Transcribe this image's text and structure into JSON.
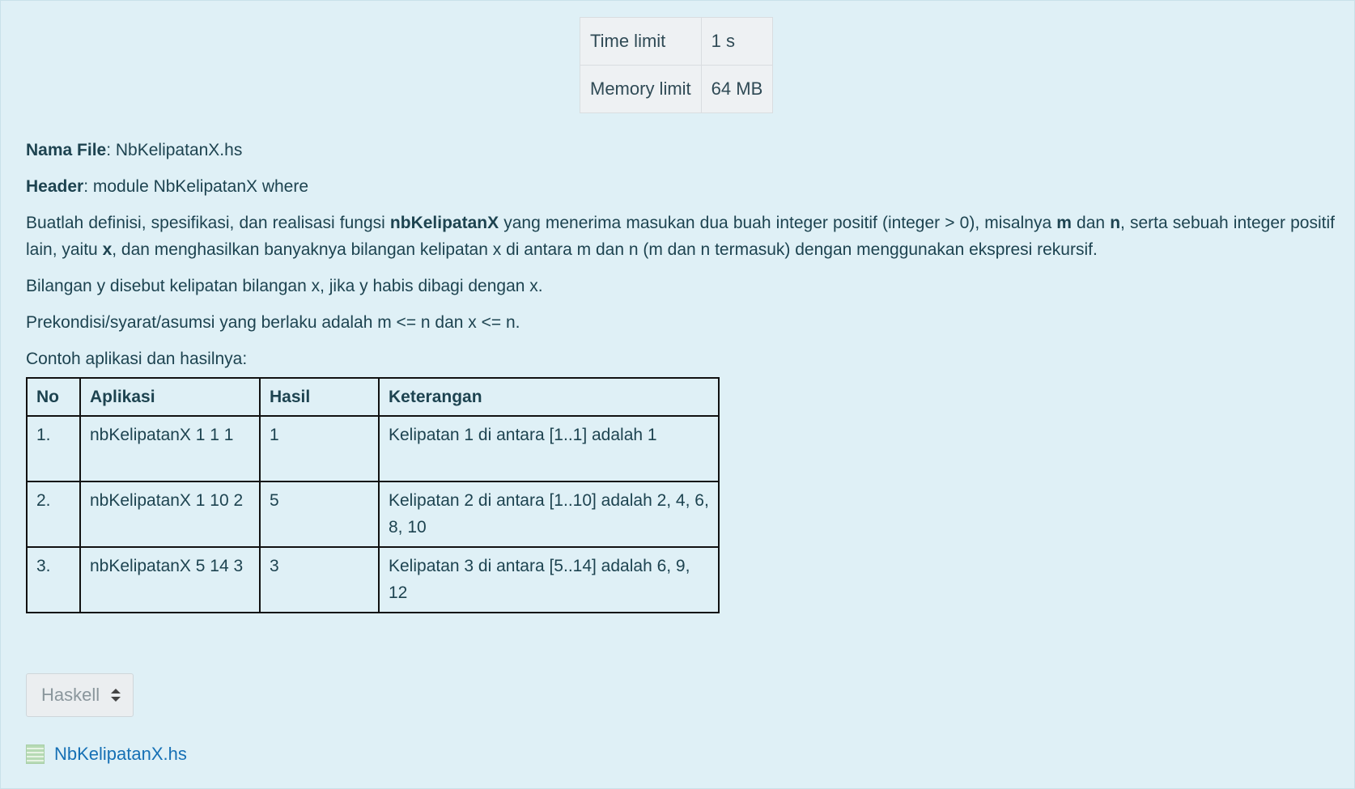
{
  "limits": [
    {
      "label": "Time limit",
      "value": "1 s"
    },
    {
      "label": "Memory limit",
      "value": "64 MB"
    }
  ],
  "file": {
    "label": "Nama File",
    "value": ": NbKelipatanX.hs"
  },
  "header": {
    "label": "Header",
    "value": ": module NbKelipatanX where"
  },
  "description": {
    "t1": "Buatlah definisi, spesifikasi, dan realisasi fungsi ",
    "fn": "nbKelipatanX",
    "t2": " yang menerima masukan dua buah integer positif (integer > 0), misalnya ",
    "m": "m",
    "t3": " dan ",
    "n": "n",
    "t4": ", serta sebuah integer positif lain, yaitu ",
    "x": "x",
    "t5": ", dan menghasilkan banyaknya bilangan kelipatan x di antara m dan n (m dan n termasuk) dengan menggunakan ekspresi rekursif."
  },
  "definition": "Bilangan y disebut kelipatan bilangan x, jika y habis dibagi dengan x.",
  "precondition": "Prekondisi/syarat/asumsi yang berlaku adalah m <= n dan x <= n.",
  "examples_intro": "Contoh aplikasi dan hasilnya:",
  "examples": {
    "headers": [
      "No",
      "Aplikasi",
      "Hasil",
      "Keterangan"
    ],
    "rows": [
      [
        "1.",
        "nbKelipatanX 1 1 1",
        "1",
        "Kelipatan 1 di antara [1..1] adalah 1"
      ],
      [
        "2.",
        "nbKelipatanX 1 10 2",
        "5",
        "Kelipatan 2 di antara [1..10] adalah 2, 4, 6, 8, 10"
      ],
      [
        "3.",
        "nbKelipatanX 5 14 3",
        "3",
        "Kelipatan 3 di antara [5..14] adalah 6, 9, 12"
      ]
    ]
  },
  "language_select": {
    "value": "Haskell"
  },
  "attachment": {
    "name": "NbKelipatanX.hs",
    "icon": "text-file-icon"
  }
}
